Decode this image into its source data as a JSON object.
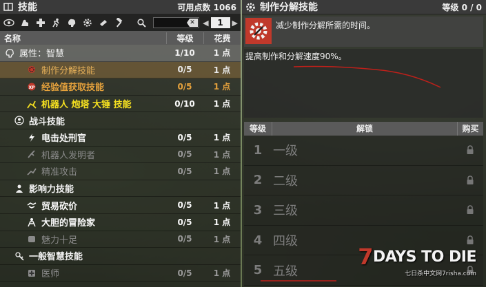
{
  "left_panel": {
    "title": "技能",
    "points_label": "可用点数",
    "points_value": "1066",
    "search": {
      "value": "",
      "placeholder": ""
    },
    "page": "1",
    "columns": {
      "name": "名称",
      "level": "等级",
      "cost": "花费"
    },
    "rows": [
      {
        "type": "attr",
        "icon": "brain-icon",
        "name": "属性：智慧",
        "level": "1/10",
        "cost": "1 点"
      },
      {
        "type": "skill",
        "style": "selected",
        "icon": "gear-wrench-icon",
        "name": "制作分解技能",
        "level": "0/5",
        "cost": "1 点"
      },
      {
        "type": "skill",
        "style": "orange",
        "icon": "exp-icon",
        "name": "经验值获取技能",
        "level": "0/5",
        "cost": "1 点"
      },
      {
        "type": "skill",
        "style": "yellow",
        "icon": "robot-arm-icon",
        "name": "机器人 炮塔 大锤 技能",
        "level": "0/10",
        "cost": "1 点"
      },
      {
        "type": "cat",
        "icon": "person-icon",
        "name": "战斗技能",
        "level": "",
        "cost": ""
      },
      {
        "type": "skill",
        "style": "bright",
        "icon": "lightning-icon",
        "name": "电击处刑官",
        "level": "0/5",
        "cost": "1 点"
      },
      {
        "type": "skill",
        "style": "dim",
        "icon": "inventor-icon",
        "name": "机器人发明者",
        "level": "0/5",
        "cost": "1 点"
      },
      {
        "type": "skill",
        "style": "dim",
        "icon": "crosshair-icon",
        "name": "精准攻击",
        "level": "0/5",
        "cost": "1 点"
      },
      {
        "type": "cat",
        "icon": "influence-icon",
        "name": "影响力技能",
        "level": "",
        "cost": ""
      },
      {
        "type": "skill",
        "style": "bright",
        "icon": "handshake-icon",
        "name": "贸易砍价",
        "level": "0/5",
        "cost": "1 点"
      },
      {
        "type": "skill",
        "style": "bright",
        "icon": "adventurer-icon",
        "name": "大胆的冒险家",
        "level": "0/5",
        "cost": "1 点"
      },
      {
        "type": "skill",
        "style": "dim",
        "icon": "charm-icon",
        "name": "魅力十足",
        "level": "0/5",
        "cost": "1 点"
      },
      {
        "type": "cat",
        "icon": "general-icon",
        "name": "一般智慧技能",
        "level": "",
        "cost": ""
      },
      {
        "type": "skill",
        "style": "dim",
        "icon": "medic-icon",
        "name": "医师",
        "level": "0/5",
        "cost": "1 点"
      }
    ]
  },
  "right_panel": {
    "title": "制作分解技能",
    "level_label": "等级",
    "level_value": "0 / 0",
    "description": "减少制作分解所需的时间。",
    "effect": "提高制作和分解速度90%。",
    "unlock_columns": {
      "level": "等级",
      "unlock": "解锁",
      "buy": "购买"
    },
    "unlocks": [
      {
        "num": "1",
        "label": "一级"
      },
      {
        "num": "2",
        "label": "二级"
      },
      {
        "num": "3",
        "label": "三级"
      },
      {
        "num": "4",
        "label": "四级"
      },
      {
        "num": "5",
        "label": "五级"
      }
    ]
  },
  "watermark": {
    "seven": "7",
    "title": "DAYS TO DIE",
    "subtitle": "七日杀中文网7risha.com"
  },
  "colors": {
    "selected_text": "#e8b25a",
    "orange": "#e6a23c",
    "yellow": "#f5e020",
    "brand_red": "#c0392b"
  }
}
